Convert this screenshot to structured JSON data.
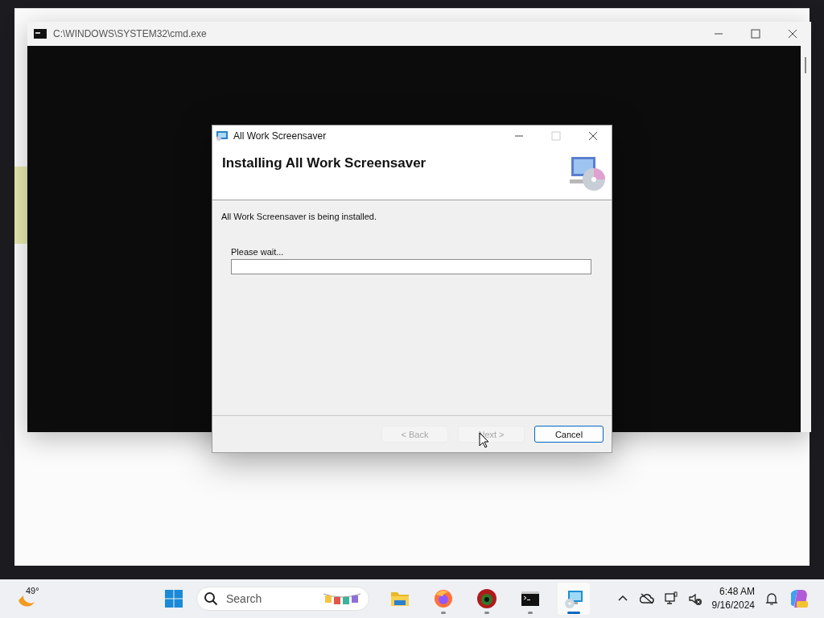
{
  "cmd_window": {
    "title": "C:\\WINDOWS\\SYSTEM32\\cmd.exe"
  },
  "dialog": {
    "title": "All Work Screensaver",
    "heading": "Installing All Work Screensaver",
    "message": "All Work Screensaver is being installed.",
    "progress": {
      "label": "Please wait...",
      "level": 0
    },
    "buttons": [
      {
        "label": "< Back",
        "disabled": true
      },
      {
        "label": "Next >",
        "disabled": true
      },
      {
        "label": "Cancel",
        "disabled": false
      }
    ]
  },
  "taskbar": {
    "weather": "49°",
    "search_placeholder": "Search",
    "apps": [
      {
        "kind": "folder",
        "running": false,
        "selected": false
      },
      {
        "kind": "browser",
        "running": true,
        "selected": false
      },
      {
        "kind": "bug",
        "running": true,
        "selected": false
      },
      {
        "kind": "terminal",
        "running": true,
        "selected": false
      },
      {
        "kind": "installer",
        "running": true,
        "selected": true
      }
    ],
    "clock": {
      "time": "6:48 AM",
      "date": "9/16/2024"
    }
  }
}
